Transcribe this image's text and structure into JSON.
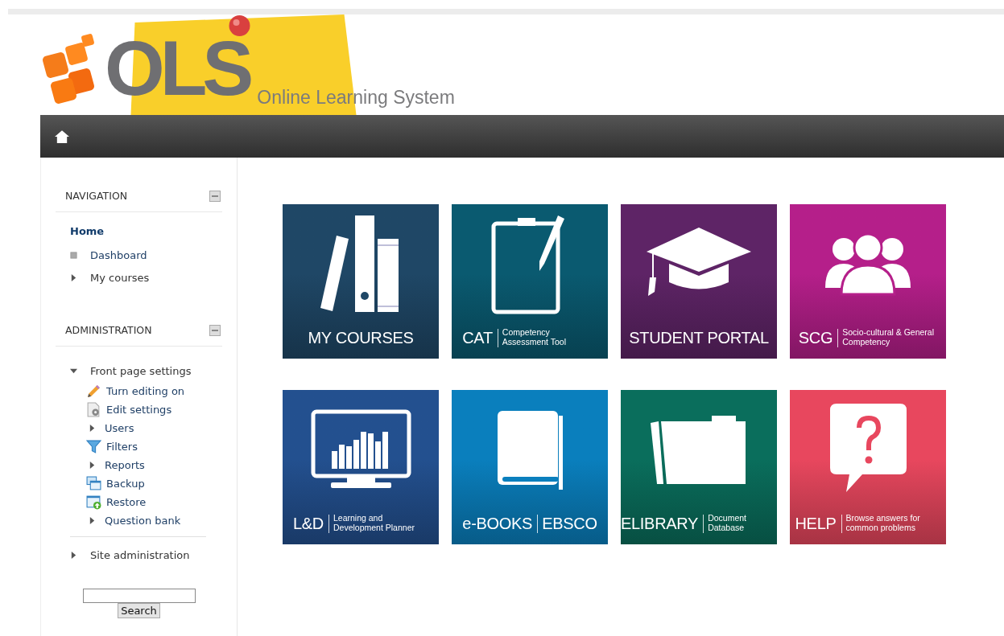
{
  "header": {
    "logo_text": "OLS",
    "tagline": "Online Learning System"
  },
  "navigation": {
    "title": "NAVIGATION",
    "home": "Home",
    "items": [
      {
        "label": "Dashboard",
        "kind": "bullet"
      },
      {
        "label": "My courses",
        "kind": "branch",
        "expanded": false
      }
    ]
  },
  "administration": {
    "title": "ADMINISTRATION",
    "items": [
      {
        "label": "Front page settings",
        "kind": "branch",
        "expanded": true,
        "children": [
          {
            "label": "Turn editing on",
            "kind": "pencil"
          },
          {
            "label": "Edit settings",
            "kind": "settings"
          },
          {
            "label": "Users",
            "kind": "branch",
            "expanded": false
          },
          {
            "label": "Filters",
            "kind": "funnel"
          },
          {
            "label": "Reports",
            "kind": "branch",
            "expanded": false
          },
          {
            "label": "Backup",
            "kind": "backup"
          },
          {
            "label": "Restore",
            "kind": "restore"
          },
          {
            "label": "Question bank",
            "kind": "branch",
            "expanded": false
          }
        ]
      },
      {
        "label": "Site administration",
        "kind": "branch",
        "expanded": false
      }
    ]
  },
  "search": {
    "button": "Search"
  },
  "tiles": [
    {
      "kind": "books",
      "title": "MY COURSES",
      "color": "#1f4766"
    },
    {
      "kind": "clipboard",
      "title": "CAT",
      "subtitle": "Competency Assessment Tool",
      "color": "#0a5a70"
    },
    {
      "kind": "cap",
      "title": "STUDENT PORTAL",
      "color": "#5e2466"
    },
    {
      "kind": "people",
      "title": "SCG",
      "subtitle": "Socio-cultural & General Competency",
      "color": "#b51f8a"
    },
    {
      "kind": "monitor",
      "title": "L&D",
      "subtitle": "Learning and Development Planner",
      "color": "#23508f"
    },
    {
      "kind": "book",
      "title": "e-BOOKS",
      "subtitle": "EBSCO",
      "color": "#0a7fbd"
    },
    {
      "kind": "folder",
      "title": "ELIBRARY",
      "subtitle": "Document Database",
      "color": "#0a6e5c"
    },
    {
      "kind": "help",
      "title": "HELP",
      "subtitle": "Browse answers for common problems",
      "color": "#e8475e"
    }
  ]
}
